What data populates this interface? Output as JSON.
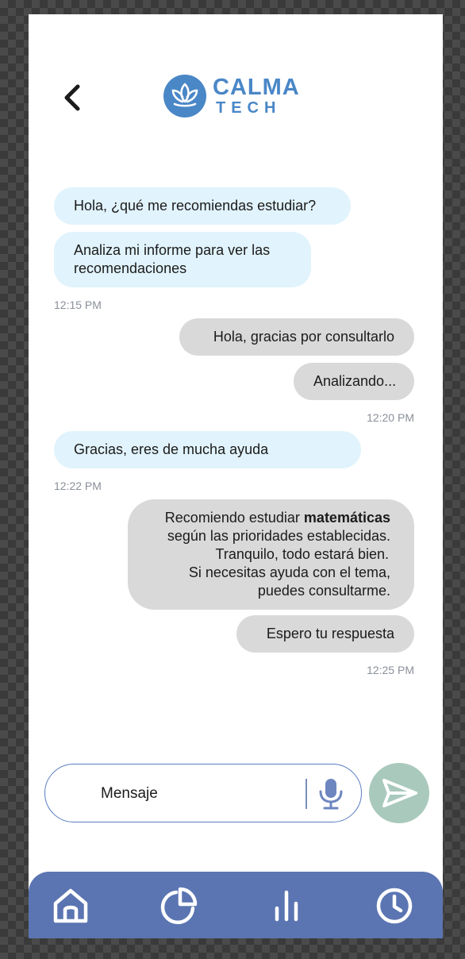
{
  "header": {
    "brand_name": "CALMA",
    "brand_sub": "TECH",
    "back_icon": "chevron-left-icon",
    "logo_icon": "lotus-icon",
    "brand_color": "#4a87c7"
  },
  "messages": [
    {
      "side": "in",
      "text": "Hola, ¿qué me recomiendas estudiar?"
    },
    {
      "side": "in",
      "lines": [
        "Analiza mi informe para ver las",
        "recomendaciones"
      ]
    },
    {
      "timestamp": "12:15 PM"
    },
    {
      "side": "out",
      "text": "Hola, gracias por consultarlo"
    },
    {
      "side": "out",
      "text": "Analizando..."
    },
    {
      "timestamp": "12:20 PM"
    },
    {
      "side": "in",
      "text": "Gracias, eres de mucha ayuda"
    },
    {
      "timestamp": "12:22 PM"
    },
    {
      "side": "out",
      "lines": [
        "Recomiendo estudiar",
        "matemáticas",
        "según las prioridades establecidas.",
        "Tranquilo, todo estará bien.",
        "Si necesitas ayuda con el tema,",
        "puedes consultarme."
      ]
    },
    {
      "side": "out",
      "text": "Espero tu respuesta"
    },
    {
      "timestamp": "12:25 PM"
    }
  ],
  "composer": {
    "text": "Mensaje",
    "mic_icon": "microphone-icon",
    "send_icon": "send-icon",
    "send_color": "#a9c9bd"
  },
  "navbar": {
    "color": "#5b75b2",
    "items": [
      "home-icon",
      "pie-chart-icon",
      "bar-chart-icon",
      "clock-icon"
    ]
  }
}
